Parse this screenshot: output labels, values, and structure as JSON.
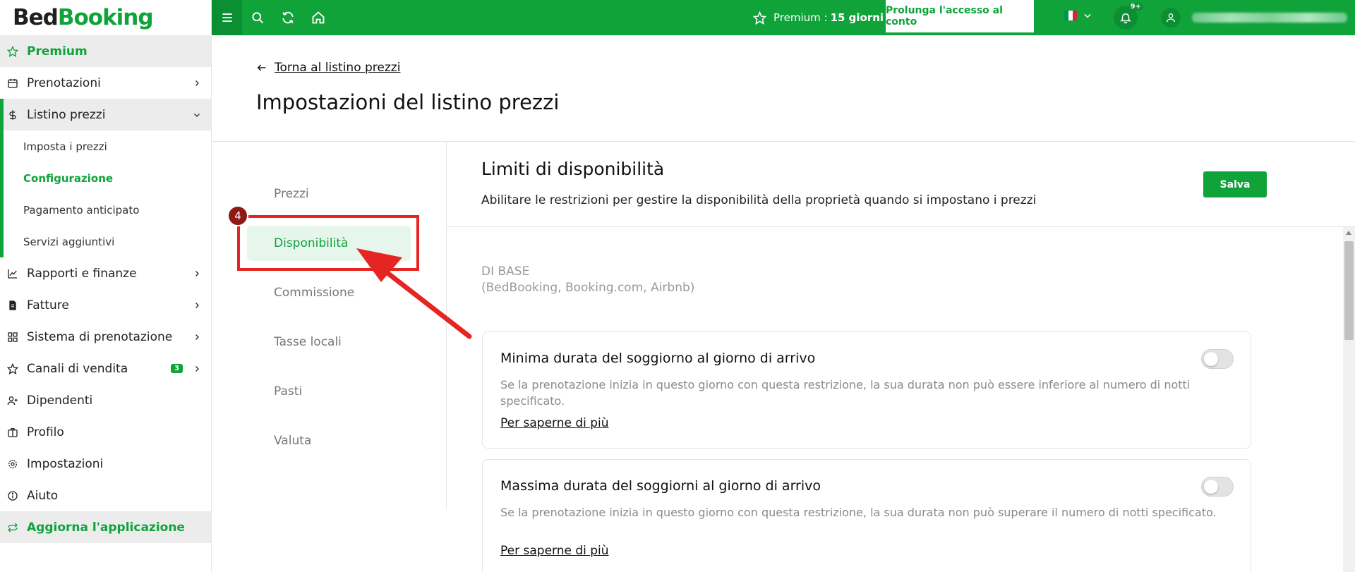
{
  "brand": {
    "part1": "Bed",
    "part2": "Booking",
    "accent": "#0fa33a"
  },
  "sidebar": {
    "premium": "Premium",
    "items": [
      {
        "label": "Prenotazioni",
        "icon": "calendar-icon"
      },
      {
        "label": "Listino prezzi",
        "icon": "dollar-icon"
      },
      {
        "label": "Rapporti e finanze",
        "icon": "chart-icon"
      },
      {
        "label": "Fatture",
        "icon": "invoice-icon"
      },
      {
        "label": "Sistema di prenotazione",
        "icon": "grid-icon"
      },
      {
        "label": "Canali di vendita",
        "icon": "star-icon",
        "badge": "3"
      },
      {
        "label": "Dipendenti",
        "icon": "user-add-icon"
      },
      {
        "label": "Profilo",
        "icon": "briefcase-icon"
      },
      {
        "label": "Impostazioni",
        "icon": "gear-icon"
      },
      {
        "label": "Aiuto",
        "icon": "info-icon"
      }
    ],
    "sub_items": [
      "Imposta i prezzi",
      "Configurazione",
      "Pagamento anticipato",
      "Servizi aggiuntivi"
    ],
    "update": "Aggiorna l'applicazione"
  },
  "topbar": {
    "premium_label": "Premium :",
    "premium_days": "15 giorni",
    "extend_button": "Prolunga l'accesso al conto",
    "notifications_count": "9+"
  },
  "main": {
    "back_link": "Torna al listino prezzi",
    "title": "Impostazioni del listino prezzi",
    "sections": [
      "Prezzi",
      "Disponibilità",
      "Commissione",
      "Tasse locali",
      "Pasti",
      "Valuta"
    ],
    "step_number": "4",
    "content_title": "Limiti di disponibilità",
    "content_desc": "Abilitare le restrizioni per gestire la disponibilità della proprietà quando si impostano i prezzi",
    "save_button": "Salva",
    "base_label_line1": "DI BASE",
    "base_label_line2": "(BedBooking, Booking.com, Airbnb)",
    "cards": [
      {
        "title": "Minima durata del soggiorno al giorno di arrivo",
        "desc": "Se la prenotazione inizia in questo giorno con questa restrizione, la sua durata non può essere inferiore al numero di notti specificato.",
        "link": "Per saperne di più",
        "enabled": false
      },
      {
        "title": "Massima durata del soggiorni al giorno di arrivo",
        "desc": "Se la prenotazione inizia in questo giorno con questa restrizione, la sua durata non può superare il numero di notti specificato.",
        "link": "Per saperne di più",
        "enabled": false
      }
    ]
  }
}
